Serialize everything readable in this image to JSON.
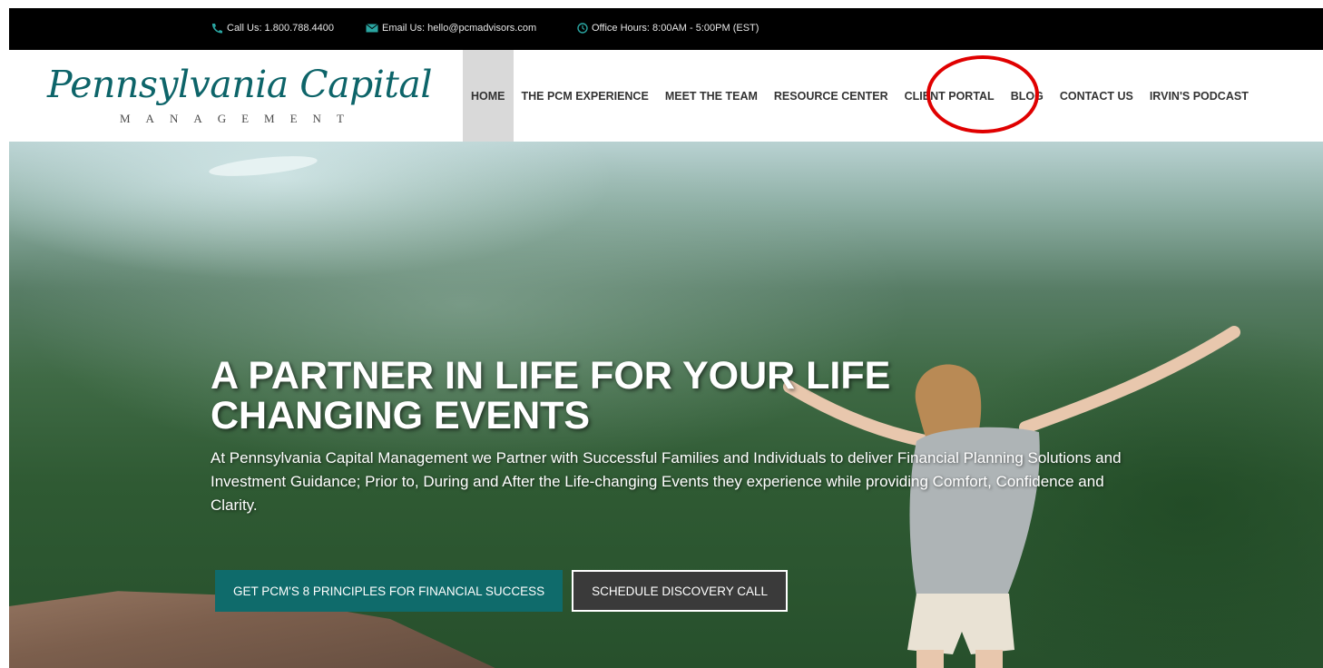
{
  "topbar": {
    "phone": "Call Us: 1.800.788.4400",
    "email": "Email Us: hello@pcmadvisors.com",
    "hours": "Office Hours: 8:00AM - 5:00PM (EST)",
    "icon_color": "#2aa5a1"
  },
  "logo": {
    "main": "Pennsylvania Capital",
    "sub": "MANAGEMENT",
    "color": "#0d6469"
  },
  "nav": {
    "items": [
      {
        "label": "HOME",
        "active": true
      },
      {
        "label": "THE PCM EXPERIENCE"
      },
      {
        "label": "MEET THE TEAM"
      },
      {
        "label": "RESOURCE CENTER"
      },
      {
        "label": "CLIENT PORTAL",
        "highlighted": true
      },
      {
        "label": "BLOG"
      },
      {
        "label": "CONTACT US"
      },
      {
        "label": "IRVIN'S PODCAST"
      }
    ],
    "highlight_color": "#e00000"
  },
  "hero": {
    "title": "A PARTNER IN LIFE FOR YOUR LIFE CHANGING EVENTS",
    "description": "At Pennsylvania Capital Management we Partner with Successful Families and Individuals to deliver Financial Planning Solutions and Investment Guidance; Prior to, During and After the Life-changing Events they experience while providing Comfort, Confidence and Clarity.",
    "primary_button": "GET PCM'S 8 PRINCIPLES FOR FINANCIAL SUCCESS",
    "secondary_button": "SCHEDULE DISCOVERY CALL",
    "primary_color": "#0f6b6b"
  }
}
